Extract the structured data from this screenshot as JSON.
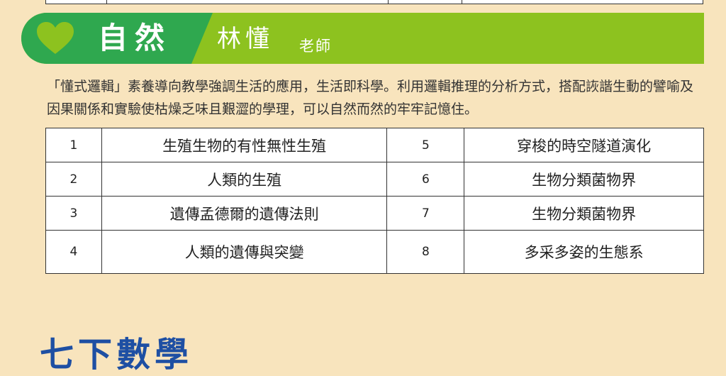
{
  "section": {
    "subject": "自然",
    "teacher_name": "林懂",
    "teacher_title": "老師"
  },
  "intro": "「懂式邏輯」素養導向教學強調生活的應用，生活即科學。利用邏輯推理的分析方式，搭配詼諧生動的譬喻及因果關係和實驗使枯燥乏味且艱澀的學理，可以自然而然的牢牢記憶住。",
  "topics": [
    {
      "left_no": "1",
      "left_topic": "生殖生物的有性無性生殖",
      "right_no": "5",
      "right_topic": "穿梭的時空隧道演化"
    },
    {
      "left_no": "2",
      "left_topic": "人類的生殖",
      "right_no": "6",
      "right_topic": "生物分類菌物界"
    },
    {
      "left_no": "3",
      "left_topic": "遺傳孟德爾的遺傳法則",
      "right_no": "7",
      "right_topic": "生物分類菌物界"
    },
    {
      "left_no": "4",
      "left_topic": "人類的遺傳與突變",
      "right_no": "8",
      "right_topic": "多采多姿的生態系"
    }
  ],
  "next_section": {
    "title": "七下數學"
  },
  "colors": {
    "banner_light": "#8dc21f",
    "banner_dark": "#2fa84f",
    "heart": "#8dc21f",
    "background": "#f8e4bd"
  }
}
